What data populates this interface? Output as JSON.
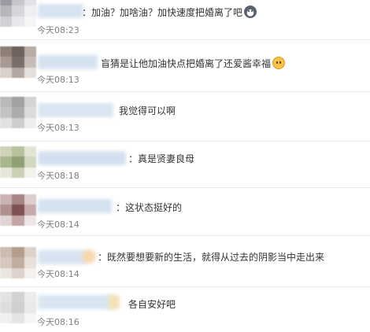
{
  "comments": [
    {
      "text": "：加油？加啥油？加快速度把婚离了吧",
      "emoji": "dog-face-emoji",
      "time": "今天08:23"
    },
    {
      "text": "盲猜是让他加油快点把婚离了还爱酱幸福",
      "emoji": "cat-face-emoji",
      "time": "今天08:13"
    },
    {
      "text": "我觉得可以啊",
      "emoji": "",
      "time": "今天08:13"
    },
    {
      "text": "：真是贤妻良母",
      "emoji": "",
      "time": "今天08:18"
    },
    {
      "text": "：这状态挺好的",
      "emoji": "",
      "time": "今天08:14"
    },
    {
      "text": "：既然要想要新的生活，就得从过去的阴影当中走出来",
      "emoji": "",
      "time": "今天08:14"
    },
    {
      "text": "各自安好吧",
      "emoji": "",
      "time": "今天08:16"
    }
  ]
}
